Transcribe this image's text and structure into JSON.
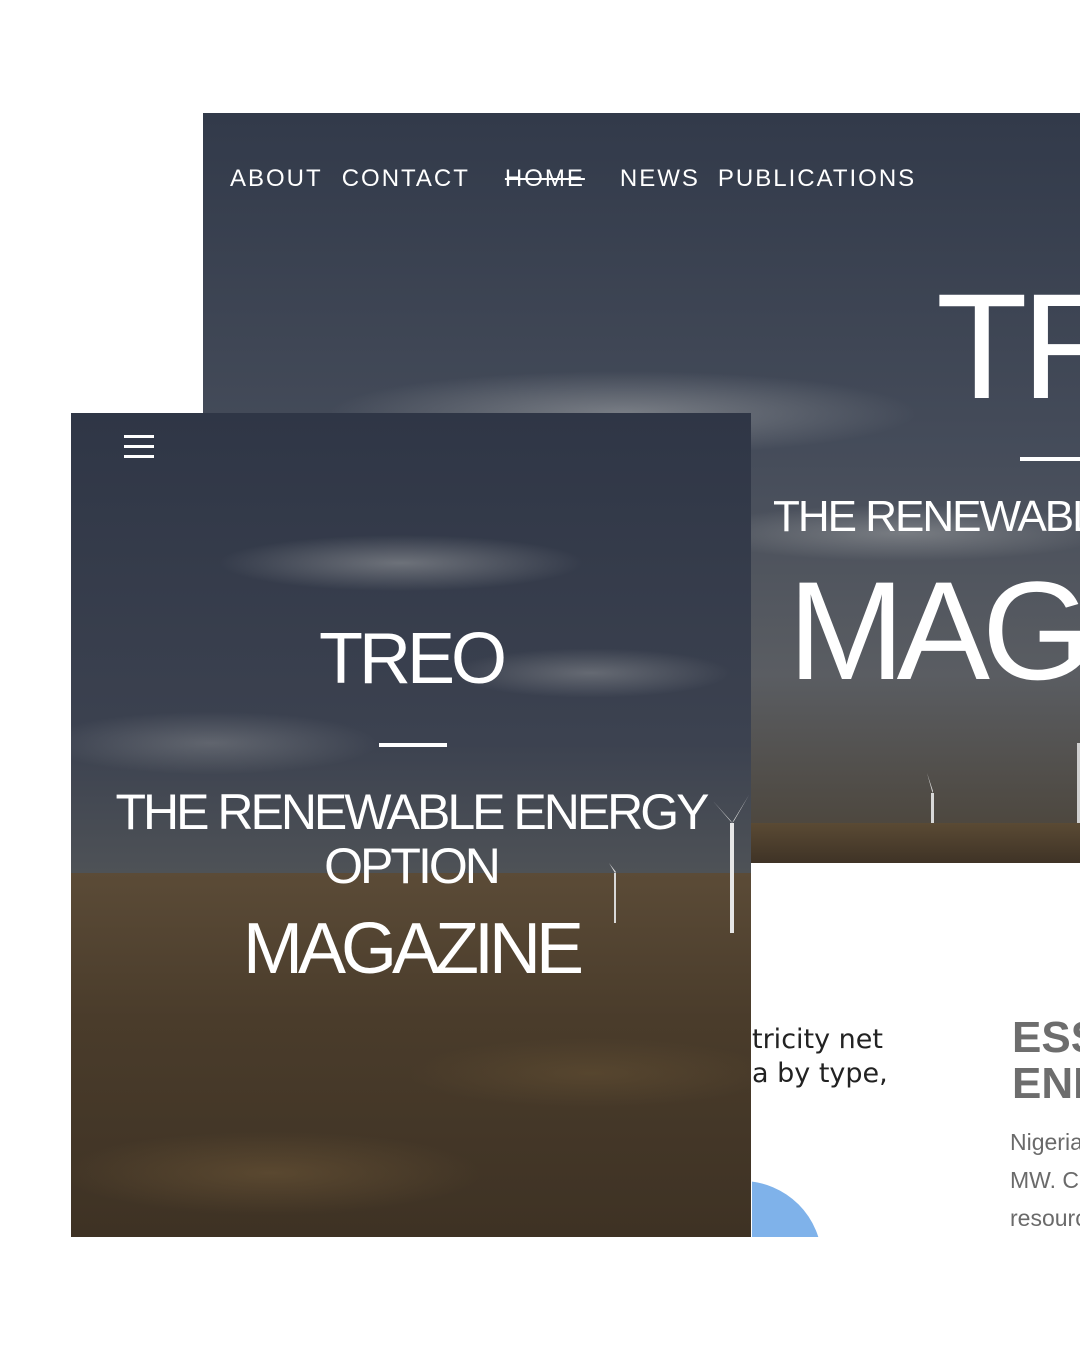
{
  "desktop": {
    "nav": [
      "ABOUT",
      "CONTACT",
      "HOME",
      "NEWS",
      "PUBLICATIONS"
    ],
    "hero": {
      "title": "TR",
      "subtitle": "THE RENEWABL",
      "magazine": "MAGA"
    }
  },
  "article": {
    "chart_caption_line1": "tricity net",
    "chart_caption_line2": "a by type,",
    "ess_title_line1": "ESS",
    "ess_title_line2": "ENE",
    "body_line1": "Nigeria",
    "body_line2": "MW. C",
    "body_line3": "resourc"
  },
  "mobile": {
    "menu_icon": "hamburger-menu-icon",
    "hero": {
      "title": "TREO",
      "subtitle_line1": "THE RENEWABLE ENERGY",
      "subtitle_line2": "OPTION",
      "magazine": "MAGAZINE"
    }
  },
  "colors": {
    "text": "#ffffff",
    "accent_pie": "#7fb2ea",
    "heading_gray": "#6d6d6d"
  }
}
